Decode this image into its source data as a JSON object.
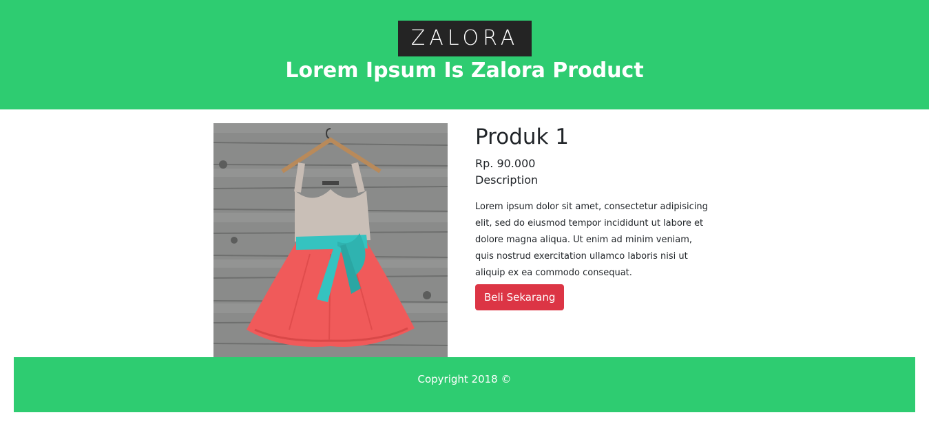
{
  "header": {
    "logo_text": "ZALORA",
    "title": "Lorem Ipsum Is Zalora Product"
  },
  "product": {
    "name": "Produk 1",
    "price": "Rp. 90.000",
    "description_label": "Description",
    "description": "Lorem ipsum dolor sit amet, consectetur adipisicing elit, sed do eiusmod tempor incididunt ut labore et dolore magna aliqua. Ut enim ad minim veniam, quis nostrud exercitation ullamco laboris nisi ut aliquip ex ea commodo consequat.",
    "buy_label": "Beli Sekarang",
    "image_subject": "dress-on-hanger"
  },
  "footer": {
    "copyright": "Copyright 2018 ©"
  },
  "colors": {
    "brand_green": "#2ecc71",
    "button_red": "#dc3545",
    "logo_bg": "#242424"
  }
}
